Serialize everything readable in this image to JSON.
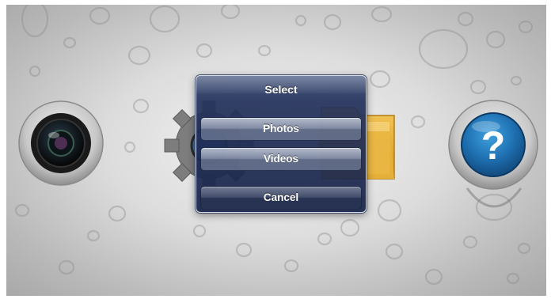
{
  "dialog": {
    "title": "Select",
    "buttons": [
      {
        "label": "Photos"
      },
      {
        "label": "Videos"
      }
    ],
    "cancel_label": "Cancel"
  },
  "home_icons": [
    {
      "icon": "camera-icon"
    },
    {
      "icon": "gear-icon"
    },
    {
      "icon": "folder-icon"
    },
    {
      "icon": "question-mark-icon"
    }
  ],
  "colors": {
    "sheet_background": "#1e2a52",
    "background": "#d0d0d0",
    "help_icon_blue": "#1e6fb0",
    "folder_yellow": "#e9b43a"
  }
}
